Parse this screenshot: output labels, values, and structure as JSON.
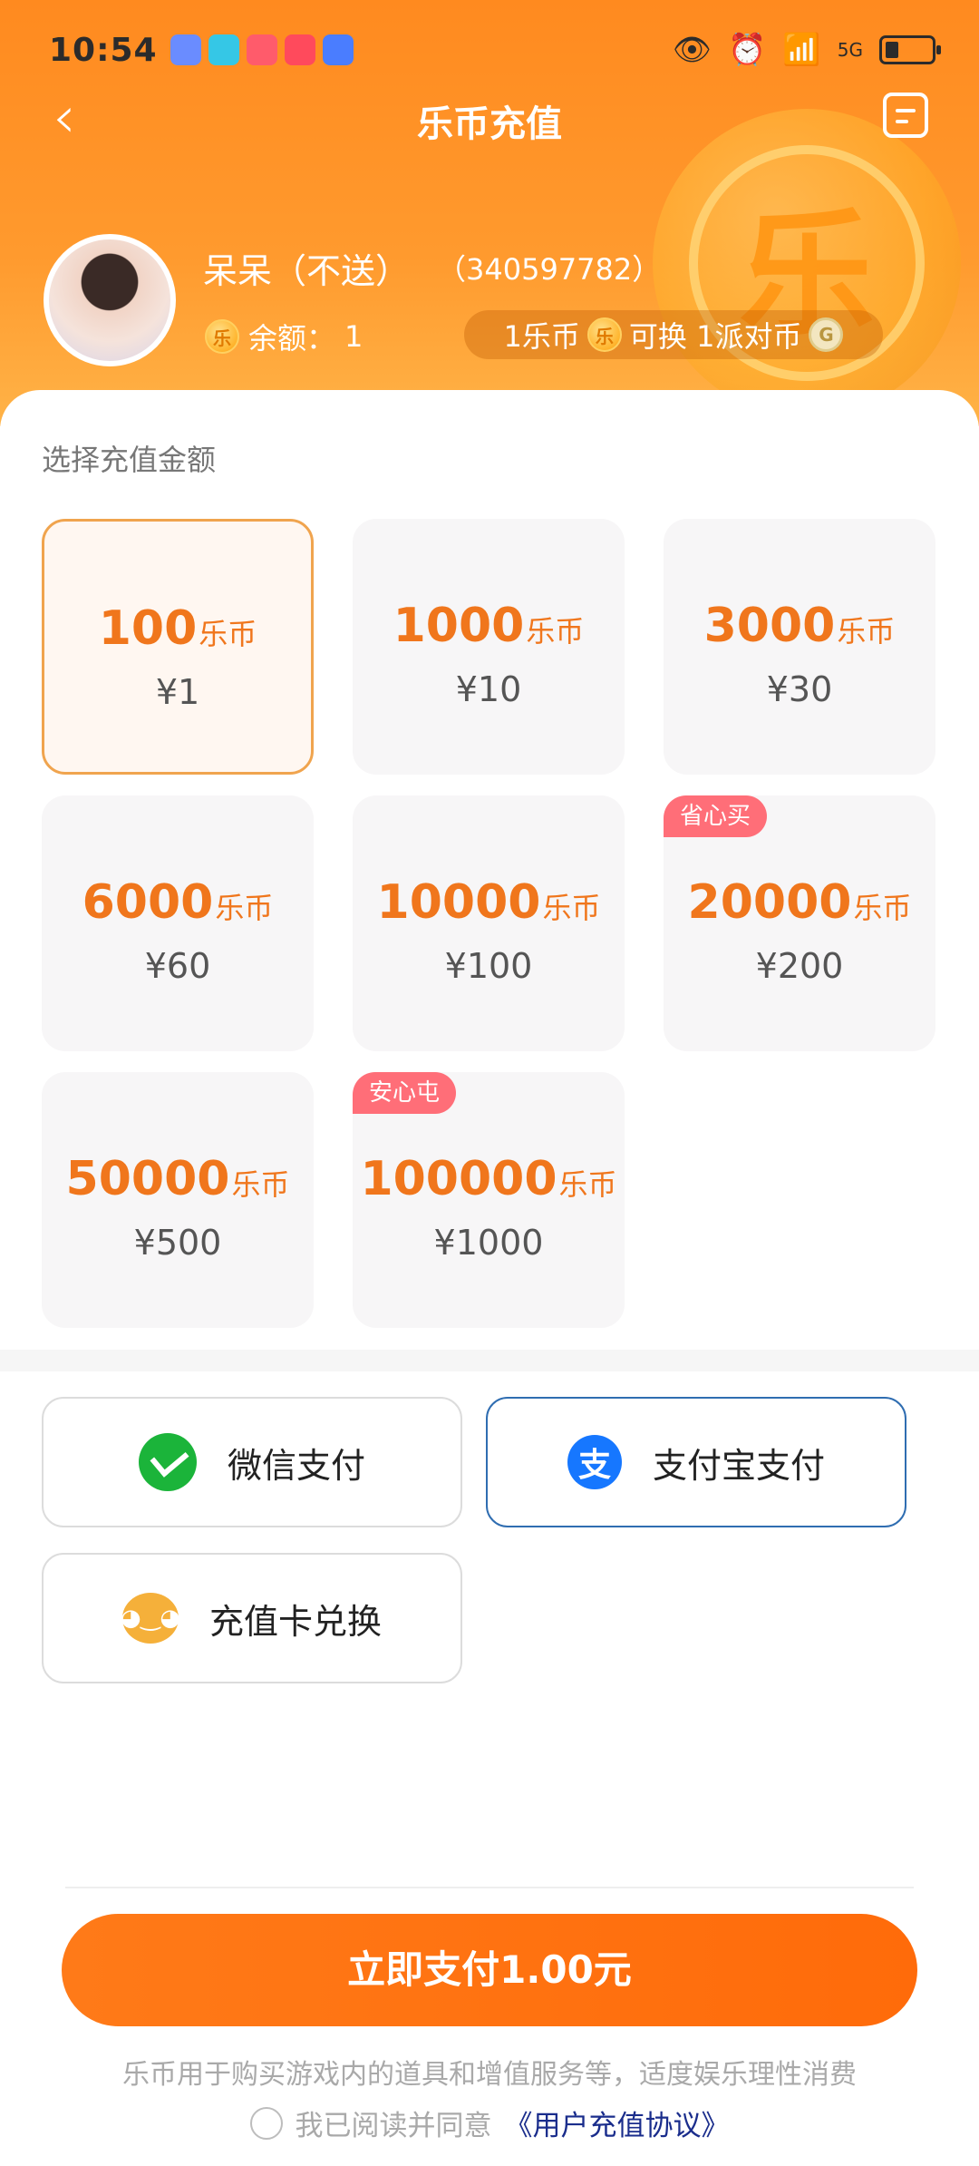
{
  "status_bar": {
    "time": "10:54",
    "network": "5G",
    "notif_colors": [
      "#6a8cff",
      "#35c7e6",
      "#ff5b6b",
      "#ff4a5c",
      "#4a7dff"
    ]
  },
  "header": {
    "title": "乐币充值",
    "username": "呆呆（不送）",
    "user_id": "（340597782）",
    "balance_label": "余额：",
    "balance_value": "1",
    "coin_glyph": "乐",
    "rate_left": "1乐币",
    "rate_middle": "可换 1派对币",
    "gem_glyph": "G"
  },
  "recharge": {
    "section_title": "选择充值金额",
    "unit": "乐币",
    "options": [
      {
        "coins": "100",
        "price": "¥1",
        "tag": ""
      },
      {
        "coins": "1000",
        "price": "¥10",
        "tag": ""
      },
      {
        "coins": "3000",
        "price": "¥30",
        "tag": ""
      },
      {
        "coins": "6000",
        "price": "¥60",
        "tag": ""
      },
      {
        "coins": "10000",
        "price": "¥100",
        "tag": ""
      },
      {
        "coins": "20000",
        "price": "¥200",
        "tag": "省心买"
      },
      {
        "coins": "50000",
        "price": "¥500",
        "tag": ""
      },
      {
        "coins": "100000",
        "price": "¥1000",
        "tag": "安心屯"
      }
    ],
    "selected_index": 0
  },
  "payment": {
    "wechat": "微信支付",
    "alipay": "支付宝支付",
    "alipay_glyph": "支",
    "card": "充值卡兑换",
    "selected": "alipay"
  },
  "footer": {
    "pay_button": "立即支付1.00元",
    "disclaimer": "乐币用于购买游戏内的道具和增值服务等，适度娱乐理性消费",
    "agree_text": "我已阅读并同意",
    "agreement_link": "《用户充值协议》"
  },
  "colors": {
    "accent": "#ff7a18",
    "selected_border": "#f0a44e",
    "price_orange": "#f0761c",
    "tag_pink": "#ff6e78",
    "alipay_blue": "#1677ff",
    "wechat_green": "#1bb43a",
    "link_blue": "#1a2d8c"
  }
}
